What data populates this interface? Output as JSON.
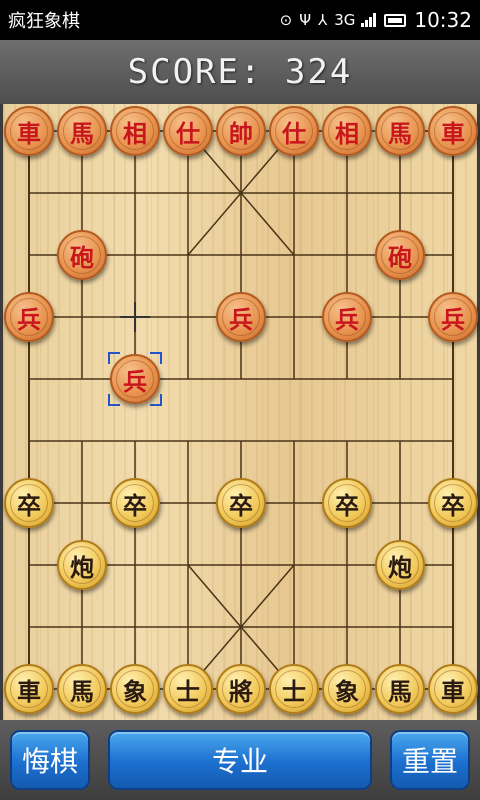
{
  "status_bar": {
    "app_title": "疯狂象棋",
    "network": "3G",
    "time": "10:32"
  },
  "game": {
    "score": "SCORE: 324"
  },
  "pieces": [
    {
      "label": "車",
      "side": "red",
      "file": 0,
      "rank": 0
    },
    {
      "label": "馬",
      "side": "red",
      "file": 1,
      "rank": 0
    },
    {
      "label": "相",
      "side": "red",
      "file": 2,
      "rank": 0
    },
    {
      "label": "仕",
      "side": "red",
      "file": 3,
      "rank": 0
    },
    {
      "label": "帥",
      "side": "red",
      "file": 4,
      "rank": 0
    },
    {
      "label": "仕",
      "side": "red",
      "file": 5,
      "rank": 0
    },
    {
      "label": "相",
      "side": "red",
      "file": 6,
      "rank": 0
    },
    {
      "label": "馬",
      "side": "red",
      "file": 7,
      "rank": 0
    },
    {
      "label": "車",
      "side": "red",
      "file": 8,
      "rank": 0
    },
    {
      "label": "砲",
      "side": "red",
      "file": 1,
      "rank": 2
    },
    {
      "label": "砲",
      "side": "red",
      "file": 7,
      "rank": 2
    },
    {
      "label": "兵",
      "side": "red",
      "file": 0,
      "rank": 3
    },
    {
      "label": "兵",
      "side": "red",
      "file": 4,
      "rank": 3
    },
    {
      "label": "兵",
      "side": "red",
      "file": 6,
      "rank": 3
    },
    {
      "label": "兵",
      "side": "red",
      "file": 8,
      "rank": 3
    },
    {
      "label": "兵",
      "side": "red",
      "file": 2,
      "rank": 4,
      "selected": true
    },
    {
      "label": "卒",
      "side": "black",
      "file": 0,
      "rank": 6
    },
    {
      "label": "卒",
      "side": "black",
      "file": 2,
      "rank": 6
    },
    {
      "label": "卒",
      "side": "black",
      "file": 4,
      "rank": 6
    },
    {
      "label": "卒",
      "side": "black",
      "file": 6,
      "rank": 6
    },
    {
      "label": "卒",
      "side": "black",
      "file": 8,
      "rank": 6
    },
    {
      "label": "炮",
      "side": "black",
      "file": 1,
      "rank": 7
    },
    {
      "label": "炮",
      "side": "black",
      "file": 7,
      "rank": 7
    },
    {
      "label": "車",
      "side": "black",
      "file": 0,
      "rank": 9
    },
    {
      "label": "馬",
      "side": "black",
      "file": 1,
      "rank": 9
    },
    {
      "label": "象",
      "side": "black",
      "file": 2,
      "rank": 9
    },
    {
      "label": "士",
      "side": "black",
      "file": 3,
      "rank": 9
    },
    {
      "label": "將",
      "side": "black",
      "file": 4,
      "rank": 9
    },
    {
      "label": "士",
      "side": "black",
      "file": 5,
      "rank": 9
    },
    {
      "label": "象",
      "side": "black",
      "file": 6,
      "rank": 9
    },
    {
      "label": "馬",
      "side": "black",
      "file": 7,
      "rank": 9
    },
    {
      "label": "車",
      "side": "black",
      "file": 8,
      "rank": 9
    }
  ],
  "cursor": {
    "file": 2,
    "rank": 3
  },
  "buttons": {
    "undo": "悔棋",
    "level": "专业",
    "reset": "重置"
  },
  "colors": {
    "red_piece_text": "#c8161c",
    "black_piece_text": "#2a1a10",
    "button_blue": "#1c6fcf"
  }
}
